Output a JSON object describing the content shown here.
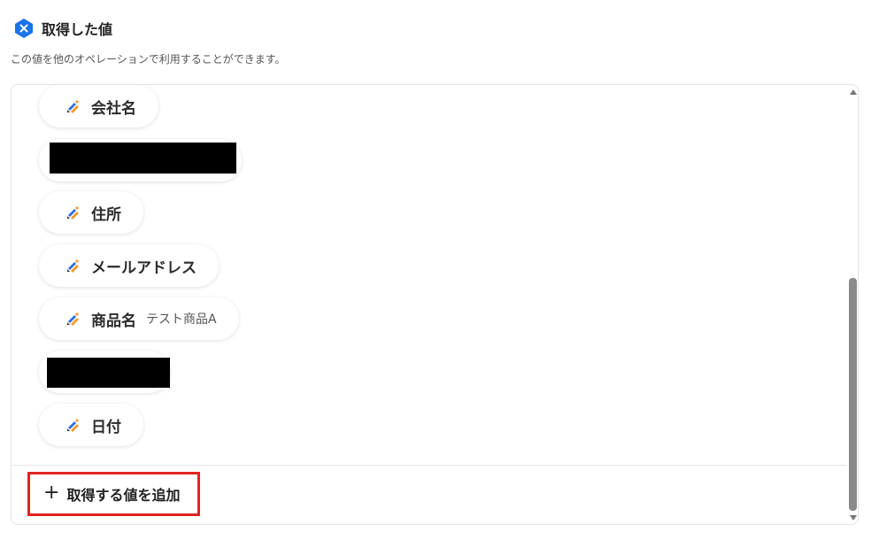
{
  "header": {
    "title": "取得した値",
    "icon": "x-badge-icon",
    "icon_color": "#1a73e8"
  },
  "subtitle": "この値を他のオペレーションで利用することができます。",
  "fields": [
    {
      "label": "会社名",
      "value": ""
    },
    {
      "label": "住所",
      "value": ""
    },
    {
      "label": "メールアドレス",
      "value": ""
    },
    {
      "label": "商品名",
      "value": "テスト商品A"
    },
    {
      "label": "日付",
      "value": ""
    }
  ],
  "add_button": {
    "icon": "plus-icon",
    "label": "取得する値を追加",
    "highlight_color": "#e02424"
  },
  "colors": {
    "chip_icon_orange": "#f29a2e",
    "chip_icon_blue": "#2f6fe0",
    "chip_icon_dark": "#333333"
  }
}
